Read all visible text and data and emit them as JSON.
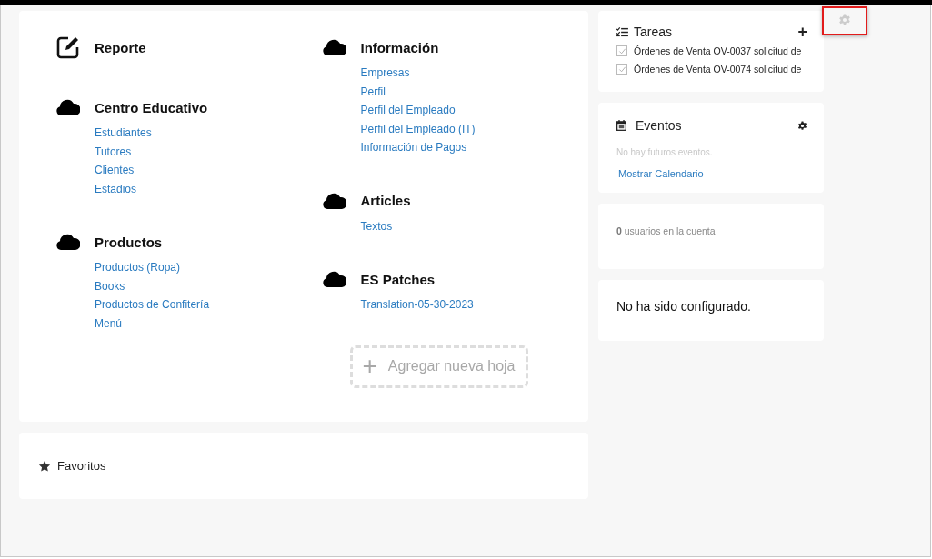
{
  "sections": [
    {
      "title": "Reporte",
      "kind": "report"
    },
    {
      "title": "Centro Educativo",
      "kind": "folder",
      "links": [
        "Estudiantes",
        "Tutores",
        "Clientes",
        "Estadios"
      ]
    },
    {
      "title": "Productos",
      "kind": "folder",
      "links": [
        "Productos (Ropa)",
        "Books",
        "Productos de Confitería",
        "Menú"
      ]
    },
    {
      "title": "Información",
      "kind": "folder",
      "links": [
        "Empresas",
        "Perfil",
        "Perfil del Empleado",
        "Perfil del Empleado (IT)",
        "Información de Pagos"
      ]
    },
    {
      "title": "Articles",
      "kind": "folder",
      "links": [
        "Textos"
      ]
    },
    {
      "title": "ES Patches",
      "kind": "folder",
      "links": [
        "Translation-05-30-2023"
      ]
    }
  ],
  "add_sheet_button": {
    "label": "Agregar nueva hoja",
    "icon": "+"
  },
  "favorites": {
    "title": "Favoritos"
  },
  "tasks": {
    "title": "Tareas",
    "add_icon": "+",
    "items": [
      {
        "text": "Órdenes de Venta OV-0037 solicitud de",
        "checked": true
      },
      {
        "text": "Órdenes de Venta OV-0074 solicitud de",
        "checked": true
      }
    ]
  },
  "events": {
    "title": "Eventos",
    "empty": "No hay futuros eventos.",
    "link": "Mostrar Calendario"
  },
  "users": {
    "count": "0",
    "text": "usuarios en la cuenta"
  },
  "config": {
    "text": "No ha sido configurado."
  }
}
